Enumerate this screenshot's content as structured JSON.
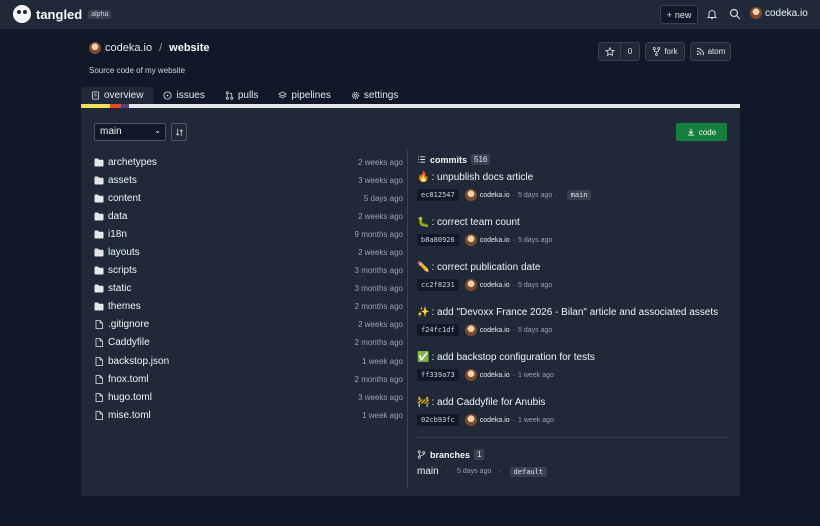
{
  "header": {
    "brand": "tangled",
    "badge": "alpha",
    "new_label": "new",
    "user": "codeka.io"
  },
  "repo": {
    "owner": "codeka.io",
    "separator": "/",
    "name": "website",
    "description": "Source code of my website",
    "star_count": "0",
    "fork_label": "fork",
    "atom_label": "atom"
  },
  "tabs": [
    {
      "label": "overview",
      "icon": "book-icon",
      "active": true
    },
    {
      "label": "issues",
      "icon": "circle-dot-icon",
      "active": false
    },
    {
      "label": "pulls",
      "icon": "git-pull-request-icon",
      "active": false
    },
    {
      "label": "pipelines",
      "icon": "layers-icon",
      "active": false
    },
    {
      "label": "settings",
      "icon": "gear-icon",
      "active": false
    }
  ],
  "language_colors": [
    "#f1e05a",
    "#e34c26",
    "#563d7c",
    "#e5e7eb"
  ],
  "toolbar": {
    "branch": "main",
    "code_label": "code"
  },
  "files": [
    {
      "name": "archetypes",
      "type": "folder",
      "date": "2 weeks ago"
    },
    {
      "name": "assets",
      "type": "folder",
      "date": "3 weeks ago"
    },
    {
      "name": "content",
      "type": "folder",
      "date": "5 days ago"
    },
    {
      "name": "data",
      "type": "folder",
      "date": "2 weeks ago"
    },
    {
      "name": "i18n",
      "type": "folder",
      "date": "9 months ago"
    },
    {
      "name": "layouts",
      "type": "folder",
      "date": "2 weeks ago"
    },
    {
      "name": "scripts",
      "type": "folder",
      "date": "3 months ago"
    },
    {
      "name": "static",
      "type": "folder",
      "date": "3 months ago"
    },
    {
      "name": "themes",
      "type": "folder",
      "date": "2 months ago"
    },
    {
      "name": ".gitignore",
      "type": "file",
      "date": "2 weeks ago"
    },
    {
      "name": "Caddyfile",
      "type": "file",
      "date": "2 months ago"
    },
    {
      "name": "backstop.json",
      "type": "file",
      "date": "1 week ago"
    },
    {
      "name": "fnox.toml",
      "type": "file",
      "date": "2 months ago"
    },
    {
      "name": "hugo.toml",
      "type": "file",
      "date": "3 weeks ago"
    },
    {
      "name": "mise.toml",
      "type": "file",
      "date": "1 week ago"
    }
  ],
  "commits": {
    "title": "commits",
    "count": "516",
    "items": [
      {
        "emoji": "🔥",
        "message": ": unpublish docs article",
        "sha": "ec812547",
        "author": "codeka.io",
        "date": "5 days ago",
        "branch": "main"
      },
      {
        "emoji": "🐛",
        "message": ": correct team count",
        "sha": "b8a80926",
        "author": "codeka.io",
        "date": "5 days ago",
        "branch": ""
      },
      {
        "emoji": "✏️",
        "message": ": correct publication date",
        "sha": "cc2f8231",
        "author": "codeka.io",
        "date": "5 days ago",
        "branch": ""
      },
      {
        "emoji": "✨",
        "message": ": add \"Devoxx France 2026 - Bilan\" article and associated assets",
        "sha": "f24fc1df",
        "author": "codeka.io",
        "date": "5 days ago",
        "branch": ""
      },
      {
        "emoji": "✅",
        "message": ": add backstop configuration for tests",
        "sha": "ff339a73",
        "author": "codeka.io",
        "date": "1 week ago",
        "branch": ""
      },
      {
        "emoji": "🚧",
        "message": ": add Caddyfile for Anubis",
        "sha": "02cb93fc",
        "author": "codeka.io",
        "date": "1 week ago",
        "branch": ""
      }
    ]
  },
  "branches": {
    "title": "branches",
    "count": "1",
    "items": [
      {
        "name": "main",
        "date": "5 days ago",
        "tag": "default"
      }
    ]
  }
}
